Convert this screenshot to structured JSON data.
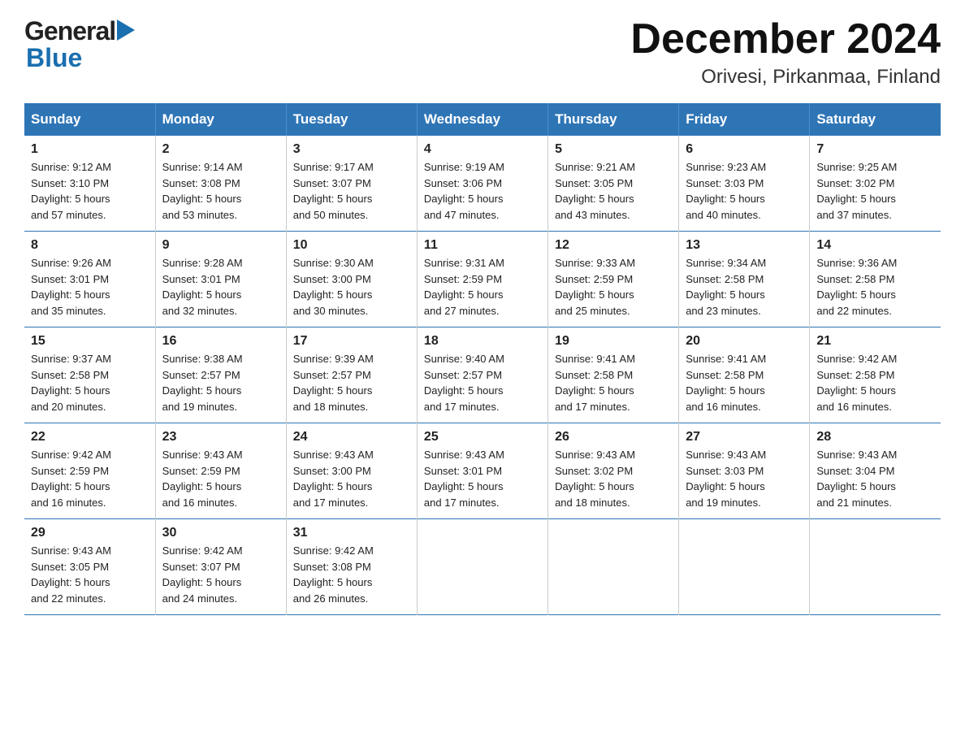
{
  "logo": {
    "general": "General",
    "blue": "Blue"
  },
  "title": "December 2024",
  "subtitle": "Orivesi, Pirkanmaa, Finland",
  "days_of_week": [
    "Sunday",
    "Monday",
    "Tuesday",
    "Wednesday",
    "Thursday",
    "Friday",
    "Saturday"
  ],
  "weeks": [
    [
      {
        "day": "1",
        "info": "Sunrise: 9:12 AM\nSunset: 3:10 PM\nDaylight: 5 hours\nand 57 minutes."
      },
      {
        "day": "2",
        "info": "Sunrise: 9:14 AM\nSunset: 3:08 PM\nDaylight: 5 hours\nand 53 minutes."
      },
      {
        "day": "3",
        "info": "Sunrise: 9:17 AM\nSunset: 3:07 PM\nDaylight: 5 hours\nand 50 minutes."
      },
      {
        "day": "4",
        "info": "Sunrise: 9:19 AM\nSunset: 3:06 PM\nDaylight: 5 hours\nand 47 minutes."
      },
      {
        "day": "5",
        "info": "Sunrise: 9:21 AM\nSunset: 3:05 PM\nDaylight: 5 hours\nand 43 minutes."
      },
      {
        "day": "6",
        "info": "Sunrise: 9:23 AM\nSunset: 3:03 PM\nDaylight: 5 hours\nand 40 minutes."
      },
      {
        "day": "7",
        "info": "Sunrise: 9:25 AM\nSunset: 3:02 PM\nDaylight: 5 hours\nand 37 minutes."
      }
    ],
    [
      {
        "day": "8",
        "info": "Sunrise: 9:26 AM\nSunset: 3:01 PM\nDaylight: 5 hours\nand 35 minutes."
      },
      {
        "day": "9",
        "info": "Sunrise: 9:28 AM\nSunset: 3:01 PM\nDaylight: 5 hours\nand 32 minutes."
      },
      {
        "day": "10",
        "info": "Sunrise: 9:30 AM\nSunset: 3:00 PM\nDaylight: 5 hours\nand 30 minutes."
      },
      {
        "day": "11",
        "info": "Sunrise: 9:31 AM\nSunset: 2:59 PM\nDaylight: 5 hours\nand 27 minutes."
      },
      {
        "day": "12",
        "info": "Sunrise: 9:33 AM\nSunset: 2:59 PM\nDaylight: 5 hours\nand 25 minutes."
      },
      {
        "day": "13",
        "info": "Sunrise: 9:34 AM\nSunset: 2:58 PM\nDaylight: 5 hours\nand 23 minutes."
      },
      {
        "day": "14",
        "info": "Sunrise: 9:36 AM\nSunset: 2:58 PM\nDaylight: 5 hours\nand 22 minutes."
      }
    ],
    [
      {
        "day": "15",
        "info": "Sunrise: 9:37 AM\nSunset: 2:58 PM\nDaylight: 5 hours\nand 20 minutes."
      },
      {
        "day": "16",
        "info": "Sunrise: 9:38 AM\nSunset: 2:57 PM\nDaylight: 5 hours\nand 19 minutes."
      },
      {
        "day": "17",
        "info": "Sunrise: 9:39 AM\nSunset: 2:57 PM\nDaylight: 5 hours\nand 18 minutes."
      },
      {
        "day": "18",
        "info": "Sunrise: 9:40 AM\nSunset: 2:57 PM\nDaylight: 5 hours\nand 17 minutes."
      },
      {
        "day": "19",
        "info": "Sunrise: 9:41 AM\nSunset: 2:58 PM\nDaylight: 5 hours\nand 17 minutes."
      },
      {
        "day": "20",
        "info": "Sunrise: 9:41 AM\nSunset: 2:58 PM\nDaylight: 5 hours\nand 16 minutes."
      },
      {
        "day": "21",
        "info": "Sunrise: 9:42 AM\nSunset: 2:58 PM\nDaylight: 5 hours\nand 16 minutes."
      }
    ],
    [
      {
        "day": "22",
        "info": "Sunrise: 9:42 AM\nSunset: 2:59 PM\nDaylight: 5 hours\nand 16 minutes."
      },
      {
        "day": "23",
        "info": "Sunrise: 9:43 AM\nSunset: 2:59 PM\nDaylight: 5 hours\nand 16 minutes."
      },
      {
        "day": "24",
        "info": "Sunrise: 9:43 AM\nSunset: 3:00 PM\nDaylight: 5 hours\nand 17 minutes."
      },
      {
        "day": "25",
        "info": "Sunrise: 9:43 AM\nSunset: 3:01 PM\nDaylight: 5 hours\nand 17 minutes."
      },
      {
        "day": "26",
        "info": "Sunrise: 9:43 AM\nSunset: 3:02 PM\nDaylight: 5 hours\nand 18 minutes."
      },
      {
        "day": "27",
        "info": "Sunrise: 9:43 AM\nSunset: 3:03 PM\nDaylight: 5 hours\nand 19 minutes."
      },
      {
        "day": "28",
        "info": "Sunrise: 9:43 AM\nSunset: 3:04 PM\nDaylight: 5 hours\nand 21 minutes."
      }
    ],
    [
      {
        "day": "29",
        "info": "Sunrise: 9:43 AM\nSunset: 3:05 PM\nDaylight: 5 hours\nand 22 minutes."
      },
      {
        "day": "30",
        "info": "Sunrise: 9:42 AM\nSunset: 3:07 PM\nDaylight: 5 hours\nand 24 minutes."
      },
      {
        "day": "31",
        "info": "Sunrise: 9:42 AM\nSunset: 3:08 PM\nDaylight: 5 hours\nand 26 minutes."
      },
      {
        "day": "",
        "info": ""
      },
      {
        "day": "",
        "info": ""
      },
      {
        "day": "",
        "info": ""
      },
      {
        "day": "",
        "info": ""
      }
    ]
  ]
}
